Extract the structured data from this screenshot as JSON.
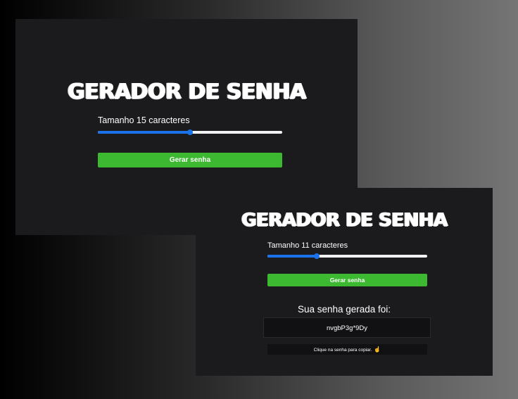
{
  "screen_before": {
    "title": "GERADOR DE SENHA",
    "length_label": "Tamanho 15 caracteres",
    "slider_level_percent": 50,
    "generate_button": "Gerar senha"
  },
  "screen_after": {
    "title": "GERADOR DE SENHA",
    "length_label": "Tamanho 11 caracteres",
    "slider_level_percent": 31,
    "generate_button": "Gerar senha",
    "result_heading": "Sua senha gerada foi:",
    "password": "nvgbP3g*9Dy",
    "copy_hint": "Clique na senha para copiar.",
    "copy_hint_icon": "pointing-hand-icon"
  },
  "colors": {
    "panel_background": "#1b1b1d",
    "button_green": "#3cb930",
    "slider_blue": "#1a73e8",
    "text": "#ffffff"
  }
}
